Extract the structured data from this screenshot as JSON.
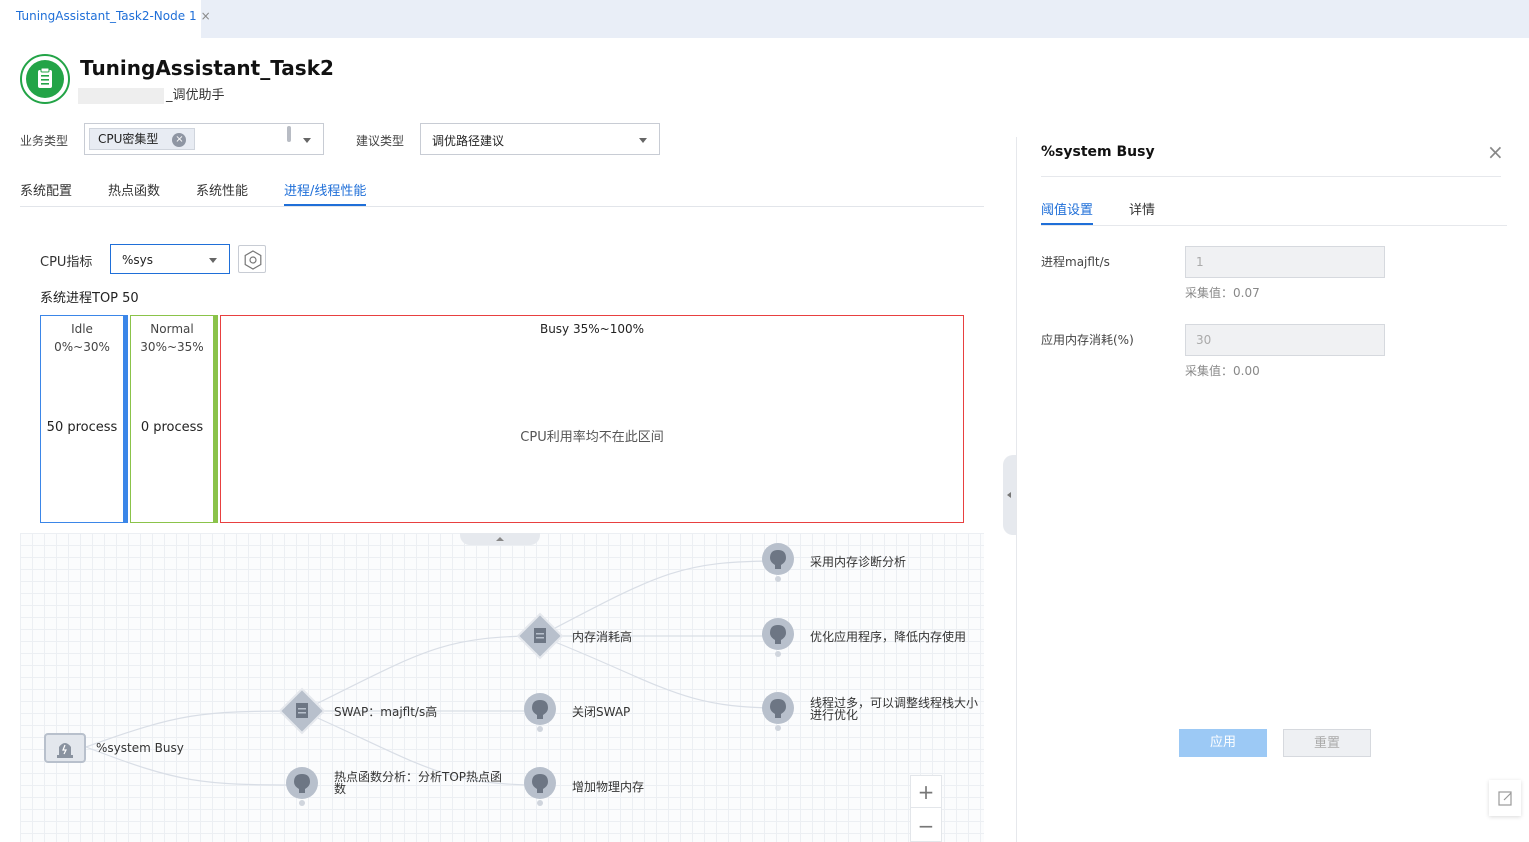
{
  "tab": {
    "label": "TuningAssistant_Task2-Node 1",
    "close": "×"
  },
  "header": {
    "title": "TuningAssistant_Task2",
    "subtitle": "_调优助手"
  },
  "filters": {
    "business_type_label": "业务类型",
    "business_type_tag": "CPU密集型",
    "suggestion_type_label": "建议类型",
    "suggestion_type_value": "调优路径建议"
  },
  "main_tabs": [
    "系统配置",
    "热点函数",
    "系统性能",
    "进程/线程性能"
  ],
  "cpu": {
    "label": "CPU指标",
    "value": "%sys"
  },
  "section_title": "系统进程TOP 50",
  "bins": [
    {
      "label": "Idle",
      "range": "0%~30%",
      "count": "50 process",
      "color": "#3b86e8"
    },
    {
      "label": "Normal",
      "range": "30%~35%",
      "count": "0 process",
      "color": "#8bc34a"
    },
    {
      "label": "Busy 35%~100%",
      "message": "CPU利用率均不在此区间",
      "color": "#e84040"
    }
  ],
  "graph": {
    "root": "%system Busy",
    "nodes": {
      "swap": "SWAP：majflt/s高",
      "hotfunc_l1": "热点函数分析：分析TOP热点函",
      "hotfunc_l2": "数",
      "mem": "内存消耗高",
      "close_swap": "关闭SWAP",
      "add_mem": "增加物理内存",
      "mem_diag": "采用内存诊断分析",
      "optimize_app": "优化应用程序，降低内存使用",
      "threads_l1": "线程过多，可以调整线程栈大小",
      "threads_l2": "进行优化"
    },
    "zoom_in": "+",
    "zoom_out": "−"
  },
  "panel": {
    "title": "%system Busy",
    "close": "×",
    "tabs": [
      "阈值设置",
      "详情"
    ],
    "fields": [
      {
        "label": "进程majflt/s",
        "value": "1",
        "collected": "采集值：0.07"
      },
      {
        "label": "应用内存消耗(%)",
        "value": "30",
        "collected": "采集值：0.00"
      }
    ],
    "apply": "应用",
    "reset": "重置"
  },
  "colors": {
    "accent": "#1f6fd8",
    "success": "#23a447",
    "node": "#b8c0cc"
  }
}
